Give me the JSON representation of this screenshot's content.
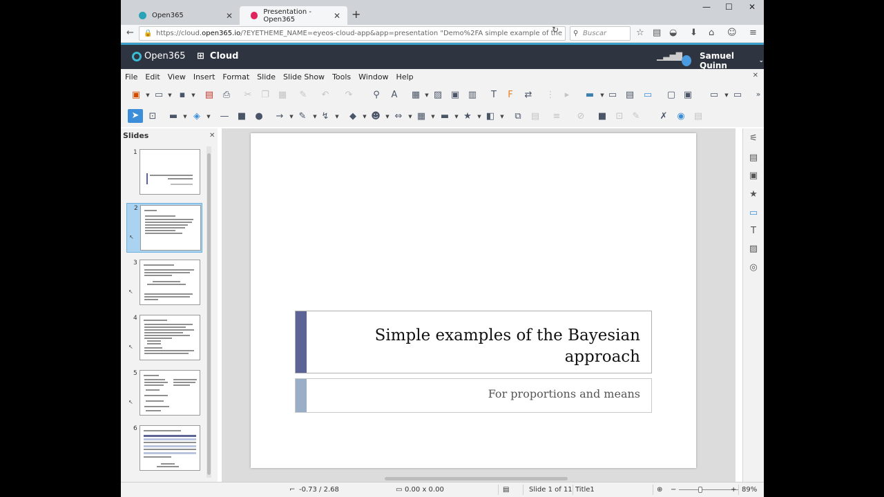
{
  "browser": {
    "tabs": [
      {
        "label": "Open365"
      },
      {
        "label": "Presentation - Open365"
      }
    ],
    "url_prefix": "https://cloud.",
    "url_domain": "open365.io",
    "url_rest": "/?EYETHEME_NAME=eyeos-cloud-app&app=presentation \"Demo%2FA simple example of the",
    "search_placeholder": "Buscar"
  },
  "app_header": {
    "logo": "Open365",
    "section": "Cloud",
    "user": "Samuel Quinn"
  },
  "menu": [
    "File",
    "Edit",
    "View",
    "Insert",
    "Format",
    "Slide",
    "Slide Show",
    "Tools",
    "Window",
    "Help"
  ],
  "slides_panel": {
    "title": "Slides",
    "thumbs": [
      {
        "num": "1"
      },
      {
        "num": "2"
      },
      {
        "num": "3"
      },
      {
        "num": "4"
      },
      {
        "num": "5"
      },
      {
        "num": "6"
      }
    ],
    "active_index": 1
  },
  "slide": {
    "title": "Simple examples of the Bayesian approach",
    "subtitle": "For proportions and means"
  },
  "status": {
    "position": "-0.73 / 2.68",
    "size": "0.00 x 0.00",
    "slide_info": "Slide 1 of 11",
    "layout": "Title1",
    "zoom": "89%"
  },
  "colors": {
    "title_accent": "#5b6494",
    "subtitle_accent": "#9aaec8",
    "header_bg": "#2e3440",
    "selected_tool": "#3c8ed8"
  }
}
